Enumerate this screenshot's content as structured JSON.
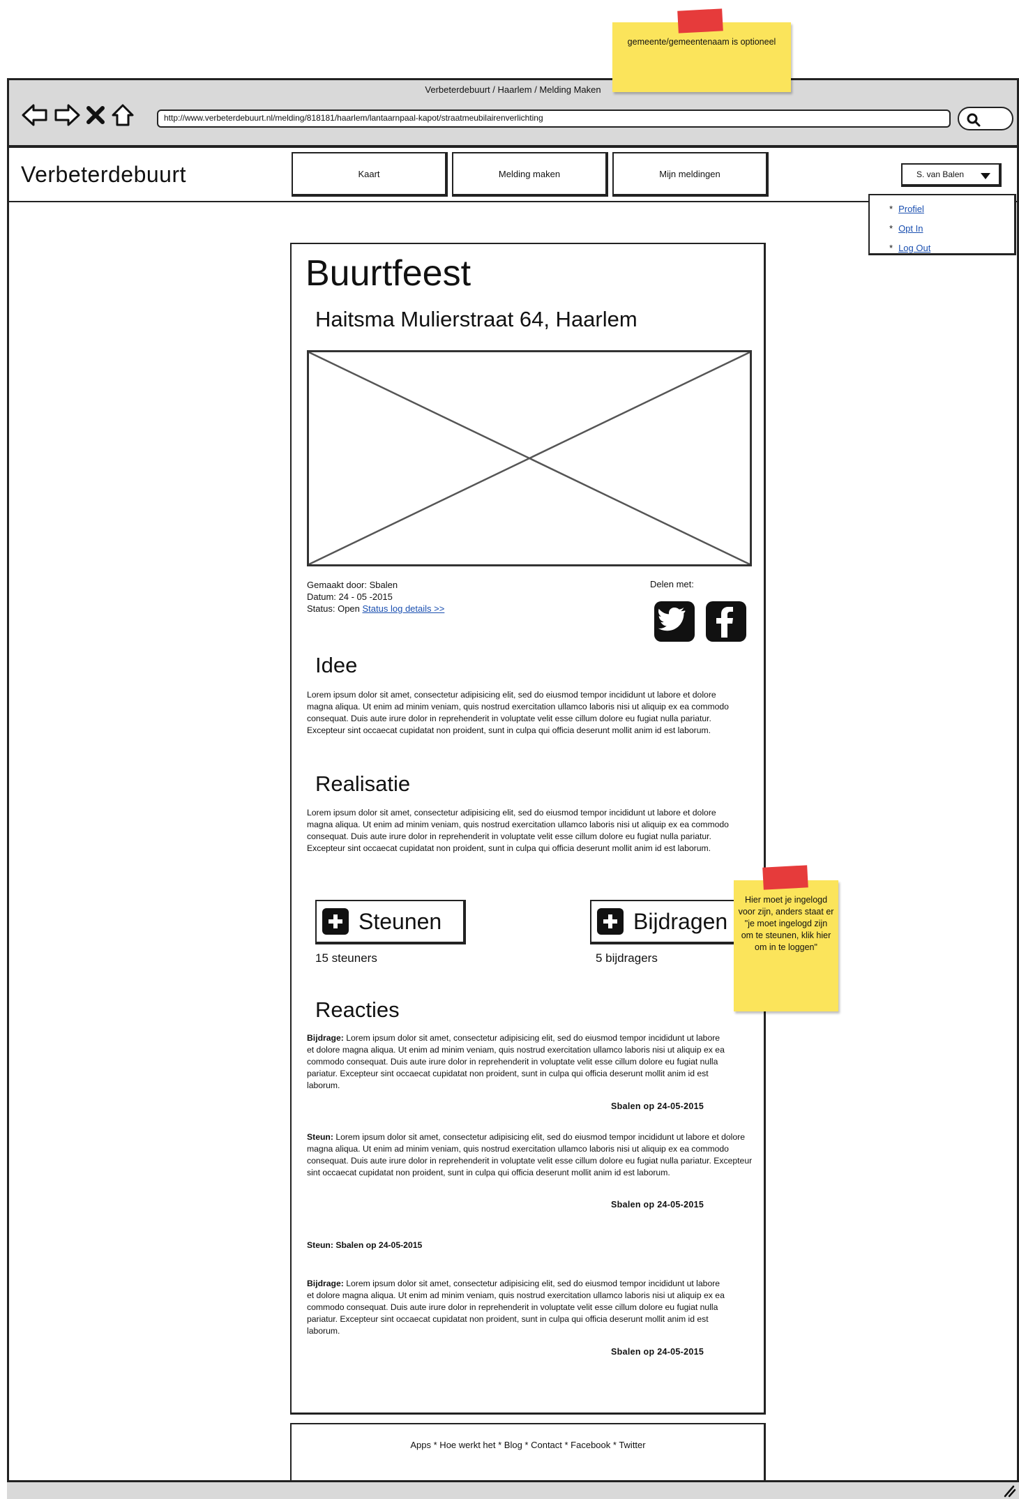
{
  "window": {
    "title": "Verbeterdebuurt / Haarlem / Melding Maken",
    "url": "http://www.verbeterdebuurt.nl/melding/818181/haarlem/lantaarnpaal-kapot/straatmeubilairenverlichting"
  },
  "header": {
    "brand": "Verbeterdebuurt",
    "nav": [
      "Kaart",
      "Melding maken",
      "Mijn meldingen"
    ],
    "user": "S. van Balen",
    "user_menu": [
      "Profiel",
      "Opt In",
      "Log Out"
    ]
  },
  "report": {
    "title": "Buurtfeest",
    "address": "Haitsma Mulierstraat 64, Haarlem",
    "made_by": "Gemaakt door: Sbalen",
    "date": "Datum: 24 - 05 -2015",
    "status_label": "Status: Open",
    "status_link": "Status log details >>",
    "share_label": "Delen met:"
  },
  "sections": {
    "idee_title": "Idee",
    "idee_text": "Lorem ipsum dolor sit amet, consectetur adipisicing elit, sed do eiusmod tempor incididunt ut labore et dolore magna aliqua. Ut enim ad minim veniam, quis nostrud exercitation ullamco laboris nisi ut aliquip ex ea commodo consequat. Duis aute irure dolor in reprehenderit in voluptate velit esse cillum dolore eu fugiat nulla pariatur. Excepteur sint occaecat cupidatat non proident, sunt in culpa qui officia deserunt mollit anim id est laborum.",
    "realisatie_title": "Realisatie",
    "realisatie_text": "Lorem ipsum dolor sit amet, consectetur adipisicing elit, sed do eiusmod tempor incididunt ut labore et dolore magna aliqua. Ut enim ad minim veniam, quis nostrud exercitation ullamco laboris nisi ut aliquip ex ea commodo consequat. Duis aute irure dolor in reprehenderit in voluptate velit esse cillum dolore eu fugiat nulla pariatur. Excepteur sint occaecat cupidatat non proident, sunt in culpa qui officia deserunt mollit anim id est laborum."
  },
  "actions": {
    "steunen_label": "Steunen",
    "steunen_count": "15 steuners",
    "bijdragen_label": "Bijdragen",
    "bijdragen_count": "5 bijdragers"
  },
  "reactions": {
    "title": "Reacties",
    "items": [
      {
        "type": "Bijdrage:",
        "text": "Lorem ipsum dolor sit amet, consectetur adipisicing elit, sed do eiusmod tempor incididunt ut labore et dolore magna aliqua. Ut enim ad minim veniam, quis nostrud exercitation ullamco laboris nisi ut aliquip ex ea commodo consequat. Duis aute irure dolor in reprehenderit in voluptate velit esse cillum dolore eu fugiat nulla pariatur. Excepteur sint occaecat cupidatat non proident, sunt in culpa qui officia deserunt mollit anim id est laborum.",
        "signature": "Sbalen op 24-05-2015"
      },
      {
        "type": "Steun:",
        "text": "Lorem ipsum dolor sit amet, consectetur adipisicing elit, sed do eiusmod tempor incididunt ut labore et dolore magna aliqua. Ut enim ad minim veniam, quis nostrud exercitation ullamco laboris nisi ut aliquip ex ea commodo consequat. Duis aute irure dolor in reprehenderit in voluptate velit esse cillum dolore eu fugiat nulla pariatur. Excepteur sint occaecat cupidatat non proident, sunt in culpa qui officia deserunt mollit anim id est laborum.",
        "signature": "Sbalen op 24-05-2015"
      },
      {
        "type": "Steun:",
        "text": "Sbalen op 24-05-2015",
        "signature": ""
      },
      {
        "type": "Bijdrage:",
        "text": "Lorem ipsum dolor sit amet, consectetur adipisicing elit, sed do eiusmod tempor incididunt ut labore et dolore magna aliqua. Ut enim ad minim veniam, quis nostrud exercitation ullamco laboris nisi ut aliquip ex ea commodo consequat. Duis aute irure dolor in reprehenderit in voluptate velit esse cillum dolore eu fugiat nulla pariatur. Excepteur sint occaecat cupidatat non proident, sunt in culpa qui officia deserunt mollit anim id est laborum.",
        "signature": "Sbalen op 24-05-2015"
      }
    ]
  },
  "footer": {
    "links": "Apps * Hoe werkt het * Blog * Contact * Facebook * Twitter"
  },
  "notes": {
    "top": "gemeente/gemeentenaam is optioneel",
    "right": "Hier moet je ingelogd voor zijn, anders staat er \"je moet ingelogd zijn om te steunen, klik hier om in te loggen\""
  },
  "icons": {
    "back": "arrow-left-icon",
    "forward": "arrow-right-icon",
    "stop": "close-icon",
    "home": "home-icon",
    "search": "search-icon",
    "twitter": "twitter-icon",
    "facebook": "facebook-icon",
    "plus": "plus-icon",
    "dropdown": "chevron-down-icon"
  },
  "colors": {
    "chrome": "#d9d9d9",
    "sticky": "#fbe45b",
    "tape": "#e63b3b",
    "link": "#1a4fb0"
  }
}
